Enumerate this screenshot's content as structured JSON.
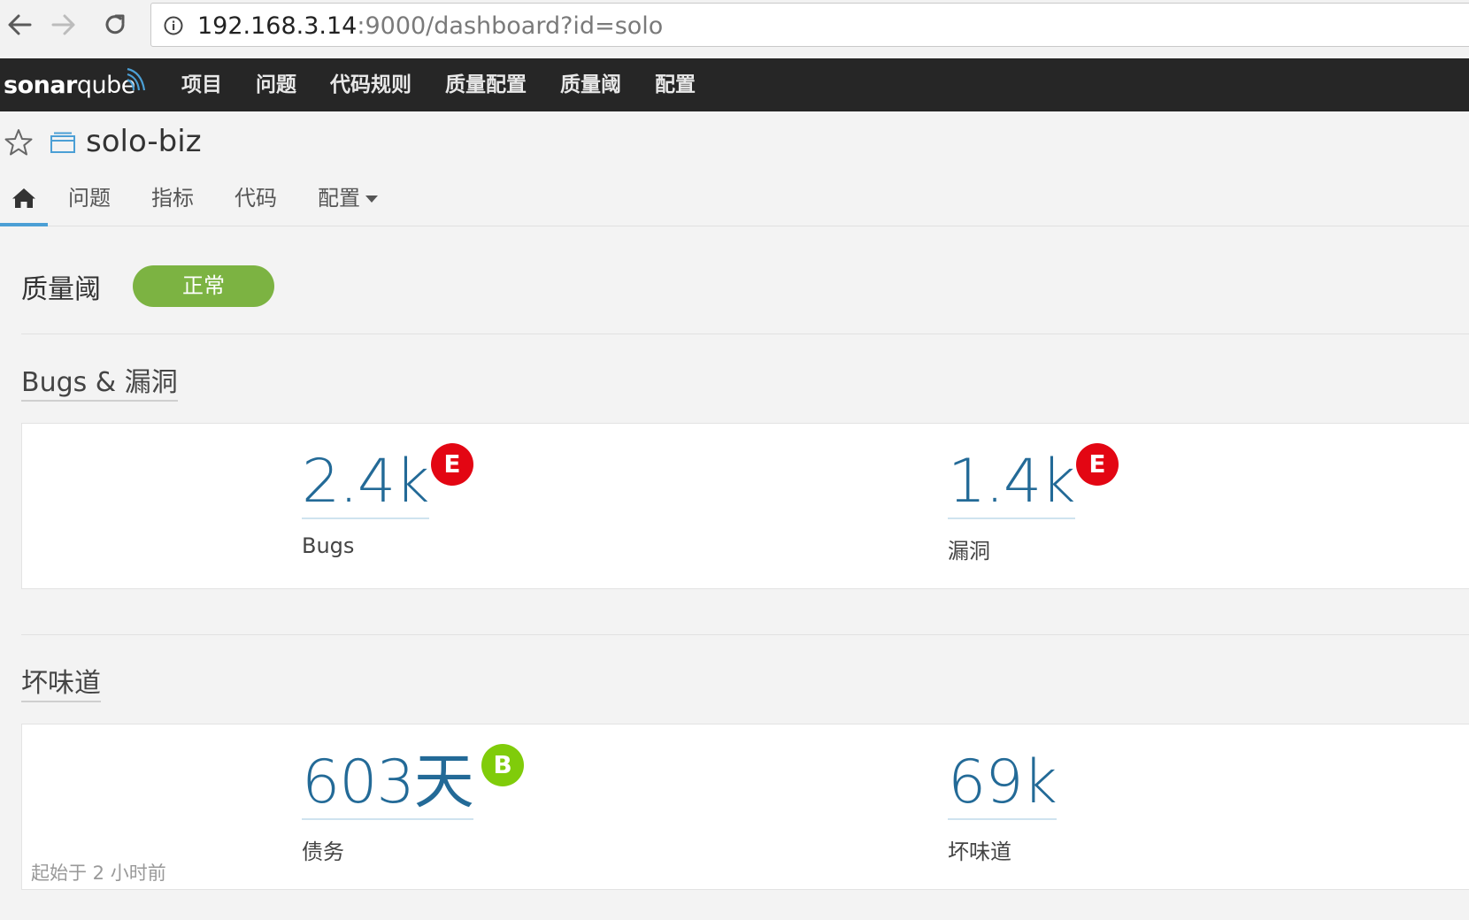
{
  "browser": {
    "url_host": "192.168.3.14",
    "url_rest": ":9000/dashboard?id=solo"
  },
  "sonar": {
    "logo_bold": "sonar",
    "logo_light": "qube",
    "menu": [
      "项目",
      "问题",
      "代码规则",
      "质量配置",
      "质量阈",
      "配置"
    ]
  },
  "project": {
    "name": "solo-biz",
    "tabs": [
      "问题",
      "指标",
      "代码"
    ],
    "config_tab": "配置"
  },
  "quality_gate": {
    "title": "质量阈",
    "status": "正常",
    "status_color": "#7cb342"
  },
  "bugs_section": {
    "title": "Bugs & 漏洞",
    "bugs": {
      "value": "2.4k",
      "label": "Bugs",
      "rating": "E"
    },
    "vulnerabilities": {
      "value": "1.4k",
      "label": "漏洞",
      "rating": "E"
    }
  },
  "smells_section": {
    "title": "坏味道",
    "debt": {
      "value": "603天",
      "label": "债务",
      "rating": "B"
    },
    "smells": {
      "value": "69k",
      "label": "坏味道"
    },
    "since": "起始于 2 小时前"
  },
  "colors": {
    "rating_e": "#e30613",
    "rating_b": "#80cc0a",
    "measure": "#236a97",
    "nav_bg": "#262626"
  }
}
